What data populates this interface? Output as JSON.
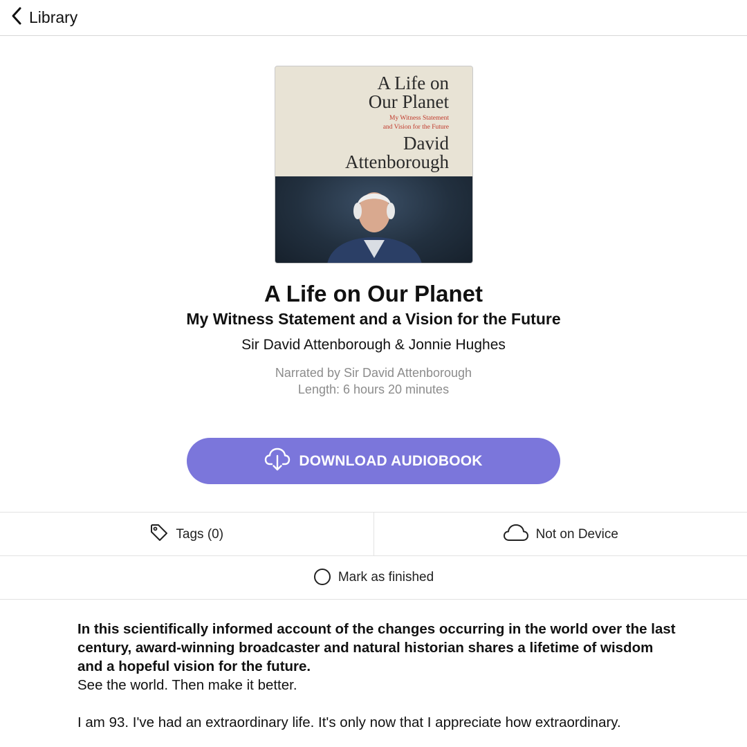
{
  "nav": {
    "back_label": "Library"
  },
  "cover": {
    "title_line1": "A Life on",
    "title_line2": "Our Planet",
    "subtitle_line1": "My Witness Statement",
    "subtitle_line2": "and Vision for the Future",
    "author_line1": "David",
    "author_line2": "Attenborough"
  },
  "book": {
    "title": "A Life on Our Planet",
    "subtitle": "My Witness Statement and a Vision for the Future",
    "authors": "Sir David Attenborough & Jonnie Hughes",
    "narrator": "Narrated by Sir David Attenborough",
    "length": "Length: 6 hours 20 minutes"
  },
  "actions": {
    "download_label": "DOWNLOAD AUDIOBOOK",
    "tags_label": "Tags (0)",
    "device_label": "Not on Device",
    "finished_label": "Mark as finished"
  },
  "description": {
    "summary": "In this scientifically informed account of the changes occurring in the world over the last century, award-winning broadcaster and natural historian shares a lifetime of wisdom and a hopeful vision for the future.",
    "tagline": "See the world. Then make it better.",
    "excerpt": "I am 93. I've had an extraordinary life. It's only now that I appreciate how extraordinary."
  },
  "colors": {
    "accent": "#7b76db"
  }
}
